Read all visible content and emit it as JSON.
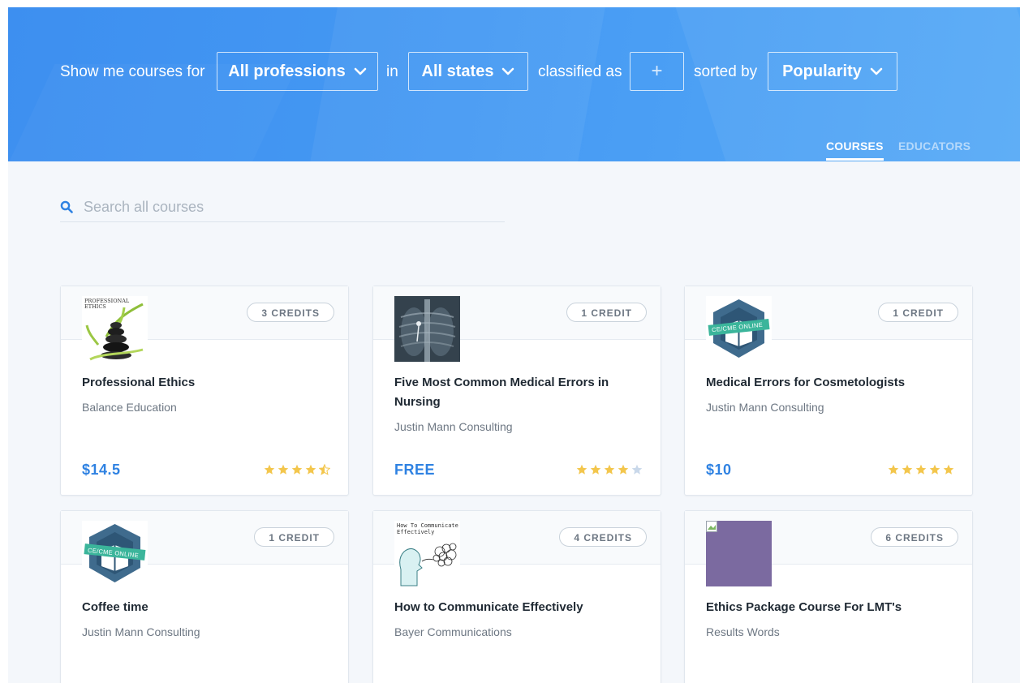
{
  "filters": {
    "show_me": "Show me courses for",
    "profession": "All professions",
    "in": "in",
    "state": "All states",
    "classified_as": "classified as",
    "classification_placeholder": "+",
    "sorted_by": "sorted by",
    "sort": "Popularity"
  },
  "tabs": {
    "courses": "COURSES",
    "educators": "EDUCATORS"
  },
  "search": {
    "placeholder": "Search all courses"
  },
  "colors": {
    "hero": "#4599f3",
    "price": "#2f82e2",
    "star_filled": "#f3c64c",
    "star_empty": "#c9d8ea"
  },
  "courses": [
    {
      "credits": "3 CREDITS",
      "title": "Professional Ethics",
      "educator": "Balance Education",
      "price": "$14.5",
      "rating": 4.5,
      "thumb": "stone-stack-image",
      "thumb_text": "PROFESSIONAL ETHICS"
    },
    {
      "credits": "1 CREDIT",
      "title": "Five Most Common Medical Errors in Nursing",
      "educator": "Justin Mann Consulting",
      "price": "FREE",
      "rating": 4,
      "thumb": "chest-xray-image"
    },
    {
      "credits": "1 CREDIT",
      "title": "Medical Errors for Cosmetologists",
      "educator": "Justin Mann Consulting",
      "price": "$10",
      "rating": 5,
      "thumb": "ce-cme-online-badge",
      "thumb_text": "CE/CME ONLINE"
    },
    {
      "credits": "1 CREDIT",
      "title": "Coffee time",
      "educator": "Justin Mann Consulting",
      "thumb": "ce-cme-online-badge",
      "thumb_text": "CE/CME ONLINE"
    },
    {
      "credits": "4 CREDITS",
      "title": "How to Communicate Effectively",
      "educator": "Bayer Communications",
      "thumb": "communicate-sketch-image",
      "thumb_text": "How To Communicate Effectively"
    },
    {
      "credits": "6 CREDITS",
      "title": "Ethics Package Course For LMT's",
      "educator": "Results Words",
      "thumb": "broken-image-placeholder"
    }
  ]
}
